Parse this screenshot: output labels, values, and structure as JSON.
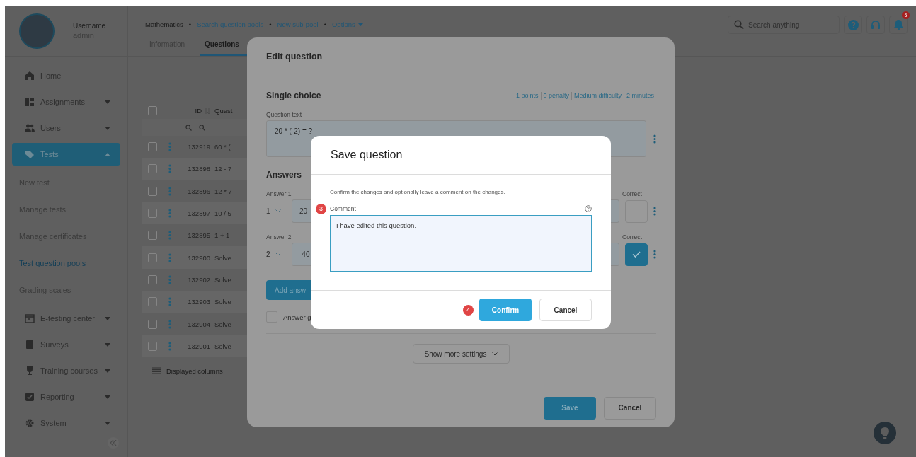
{
  "user": {
    "label": "Username",
    "name": "admin"
  },
  "sidebar": {
    "items": [
      {
        "kind": "link",
        "label": "Home",
        "selected": false
      },
      {
        "kind": "group",
        "label": "Assignments",
        "selected": false,
        "expanded": false
      },
      {
        "kind": "group",
        "label": "Users",
        "selected": false,
        "expanded": false
      },
      {
        "kind": "group",
        "label": "Tests",
        "selected": true,
        "expanded": true,
        "children": [
          {
            "label": "New test",
            "selected": false
          },
          {
            "label": "Manage tests",
            "selected": false
          },
          {
            "label": "Manage certificates",
            "selected": false
          },
          {
            "label": "Test question pools",
            "selected": true
          },
          {
            "label": "Grading scales",
            "selected": false
          }
        ]
      },
      {
        "kind": "group",
        "label": "E-testing center",
        "selected": false,
        "expanded": false
      },
      {
        "kind": "group",
        "label": "Surveys",
        "selected": false,
        "expanded": false
      },
      {
        "kind": "group",
        "label": "Training courses",
        "selected": false,
        "expanded": false
      },
      {
        "kind": "group",
        "label": "Reporting",
        "selected": false,
        "expanded": false
      },
      {
        "kind": "group",
        "label": "System",
        "selected": false,
        "expanded": false
      }
    ]
  },
  "breadcrumb": [
    {
      "kind": "text",
      "label": "Mathematics"
    },
    {
      "kind": "separator",
      "label": "•"
    },
    {
      "kind": "link",
      "label": "Search question pools"
    },
    {
      "kind": "separator",
      "label": "•"
    },
    {
      "kind": "link",
      "label": "New sub-pool"
    },
    {
      "kind": "separator",
      "label": "•"
    },
    {
      "kind": "menu",
      "label": "Options"
    }
  ],
  "tabs": [
    {
      "label": "Information",
      "selected": false
    },
    {
      "label": "Questions",
      "selected": true
    }
  ],
  "search": {
    "placeholder": "Search anything"
  },
  "notifications": {
    "count": "5"
  },
  "table": {
    "columns": [
      "ID",
      "Quest"
    ],
    "select_all": false,
    "rows": [
      {
        "id": "132919",
        "question": "60 * (",
        "checked": false
      },
      {
        "id": "132898",
        "question": "12 - 7",
        "checked": false
      },
      {
        "id": "132896",
        "question": "12 * 7",
        "checked": false
      },
      {
        "id": "132897",
        "question": "10 / 5",
        "checked": false
      },
      {
        "id": "132895",
        "question": "1 + 1",
        "checked": false
      },
      {
        "id": "132900",
        "question": "Solve",
        "checked": false
      },
      {
        "id": "132902",
        "question": "Solve",
        "checked": false
      },
      {
        "id": "132903",
        "question": "Solve",
        "checked": false
      },
      {
        "id": "132904",
        "question": "Solve",
        "checked": false
      },
      {
        "id": "132901",
        "question": "Solve",
        "checked": false
      }
    ],
    "footer": "Displayed columns"
  },
  "edit_dialog": {
    "title": "Edit question",
    "type": "Single choice",
    "meta": [
      "1 points",
      "0 penalty",
      "Medium difficulty",
      "2 minutes"
    ],
    "question_label": "Question text",
    "question": "20 * (-2) = ?",
    "answers_title": "Answers",
    "answers": [
      {
        "label": "Answer 1",
        "number": "1",
        "value": "20",
        "correct_label": "Correct",
        "correct": false
      },
      {
        "label": "Answer 2",
        "number": "2",
        "value": "-40",
        "correct_label": "Correct",
        "correct": true
      }
    ],
    "add_button": "Add answ",
    "option": {
      "label": "Answer g",
      "checked": false
    },
    "more_button": "Show more settings",
    "buttons": [
      "Save",
      "Cancel"
    ]
  },
  "save_dialog": {
    "title": "Save question",
    "description": "Confirm the changes and optionally leave a comment on the changes.",
    "comment_step": "3",
    "comment_label": "Comment",
    "comment": "I have edited this question.",
    "confirm_step": "4",
    "buttons": [
      "Confirm",
      "Cancel"
    ]
  }
}
